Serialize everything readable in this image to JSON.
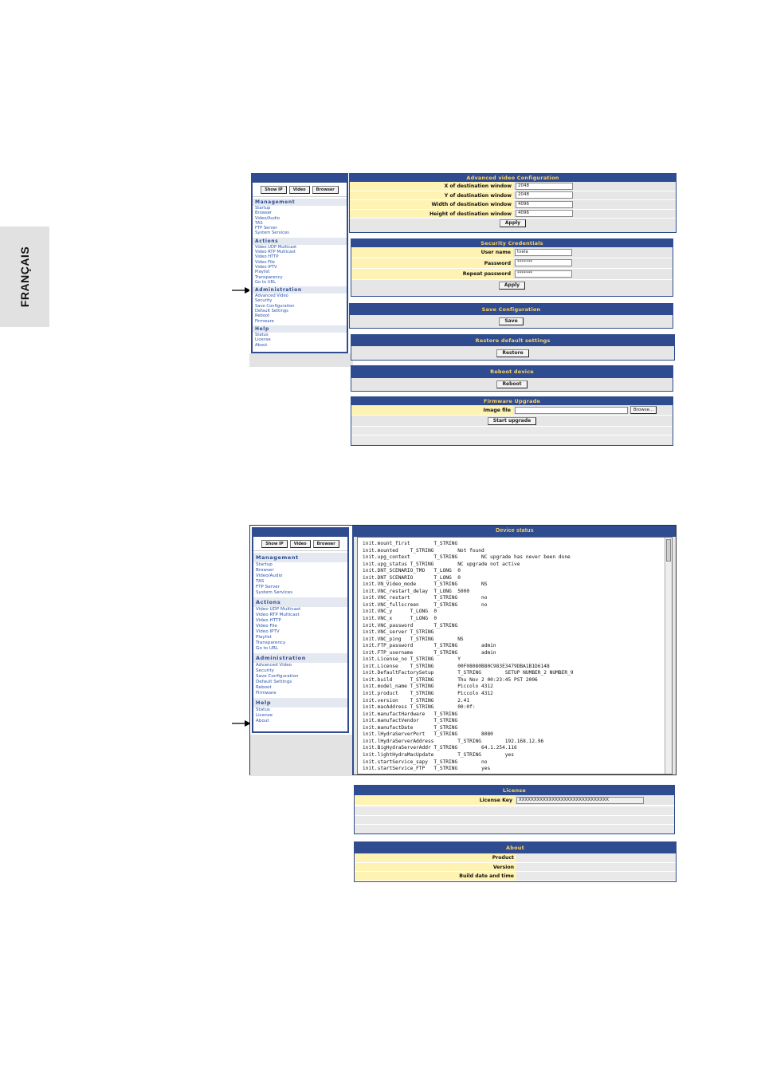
{
  "side_tab": "FRANÇAIS",
  "sidebar1": {
    "buttons": [
      "Show IP",
      "Video",
      "Browser"
    ],
    "sections": [
      {
        "title": "Management",
        "items": [
          "Startup",
          "Browser",
          "Video/Audio",
          "TAS",
          "FTP Server",
          "System Services"
        ]
      },
      {
        "title": "Actions",
        "items": [
          "Video UDP Multicast",
          "Video RTP Multicast",
          "Video HTTP",
          "Video File",
          "Video IPTV",
          "Playlist",
          "Transparency",
          "Go to URL"
        ]
      },
      {
        "title": "Administration",
        "items": [
          "Advanced Video",
          "Security",
          "Save Configuration",
          "Default Settings",
          "Reboot",
          "Firmware"
        ]
      },
      {
        "title": "Help",
        "items": [
          "Status",
          "License",
          "About"
        ]
      }
    ]
  },
  "advanced_video": {
    "title": "Advanced video Configuration",
    "fields": [
      {
        "label": "X of destination window",
        "value": "2048"
      },
      {
        "label": "Y of destination window",
        "value": "2048"
      },
      {
        "label": "Width of destination window",
        "value": "4096"
      },
      {
        "label": "Height of destination window",
        "value": "4096"
      }
    ],
    "apply": "Apply"
  },
  "security": {
    "title": "Security Credentials",
    "fields": [
      {
        "label": "User name",
        "value": "tvela"
      },
      {
        "label": "Password",
        "value": "*******"
      },
      {
        "label": "Repeat password",
        "value": "*******"
      }
    ],
    "apply": "Apply"
  },
  "save_config": {
    "title": "Save Configuration",
    "button": "Save"
  },
  "restore": {
    "title": "Restore default settings",
    "button": "Restore"
  },
  "reboot": {
    "title": "Reboot device",
    "button": "Reboot"
  },
  "firmware": {
    "title": "Firmware Upgrade",
    "label": "Image file",
    "browse": "Browse...",
    "start": "Start upgrade"
  },
  "device_status": {
    "title": "Device status",
    "lines": [
      "init.mount_first        T_STRING",
      "init.mounted    T_STRING        Not found",
      "init.upg_context        T_STRING        NC upgrade has never been done",
      "init.upg_status T_STRING        NC upgrade not active",
      "init.DNT_SCENARIO_TMO   T_LONG  0",
      "init.DNT_SCENARIO       T_LONG  0",
      "init.VN_Video_mode      T_STRING        NS",
      "init.VNC_restart_delay  T_LONG  5000",
      "init.VNC_restart        T_STRING        no",
      "init.VNC_fullscreen     T_STRING        no",
      "init.VNC_y      T_LONG  0",
      "init.VNC_x      T_LONG  0",
      "init.VNC_password       T_STRING",
      "init.VNC_server T_STRING",
      "init.VNC_ping   T_STRING        NS",
      "init.FTP_password       T_STRING        admin",
      "init.FTP_username       T_STRING        admin",
      "init.License_no T_STRING        Y",
      "init.License    T_STRING        00F08080B80C983E3479DBA1B1D6148",
      "init.DefaultFactorySetup        T_STRING        SETUP NUMBER_2 NUMBER_9",
      "init.build      T_STRING        Thu Nov 2 00:23:45 PST 2006",
      "init.model_name T_STRING        Piccolo 4312",
      "init.product    T_STRING        Piccolo 4312",
      "init.version    T_STRING        2.41",
      "init.macAddress T_STRING        00:0f:",
      "init.manufactHardware   T_STRING",
      "init.manufactVendor     T_STRING",
      "init.manufactDate       T_STRING",
      "init.lHydraServerPort   T_STRING        8080",
      "init.lHydraServerAddress        T_STRING        192.168.12.96",
      "init.BigHydraServerAddr T_STRING        64.1.254.116",
      "init.lightHydraMacUpdate        T_STRING        yes",
      "init.startService_sapy  T_STRING        no",
      "init.startService_FTP   T_STRING        yes"
    ]
  },
  "sidebar2": {
    "buttons": [
      "Show IP",
      "Video",
      "Browser"
    ],
    "sections": [
      {
        "title": "Management",
        "items": [
          "Startup",
          "Browser",
          "Video/Audio",
          "TAS",
          "FTP Server",
          "System Services"
        ]
      },
      {
        "title": "Actions",
        "items": [
          "Video UDP Multicast",
          "Video RTP Multicast",
          "Video HTTP",
          "Video File",
          "Video IPTV",
          "Playlist",
          "Transparency",
          "Go to URL"
        ]
      },
      {
        "title": "Administration",
        "items": [
          "Advanced Video",
          "Security",
          "Save Configuration",
          "Default Settings",
          "Reboot",
          "Firmware"
        ]
      },
      {
        "title": "Help",
        "items": [
          "Status",
          "License",
          "About"
        ]
      }
    ]
  },
  "license": {
    "title": "License",
    "label": "License Key",
    "value": "XXXXXXXXXXXXXXXXXXXXXXXXXXXXXX"
  },
  "about": {
    "title": "About",
    "rows": [
      "Product",
      "Version",
      "Build date and time"
    ]
  }
}
